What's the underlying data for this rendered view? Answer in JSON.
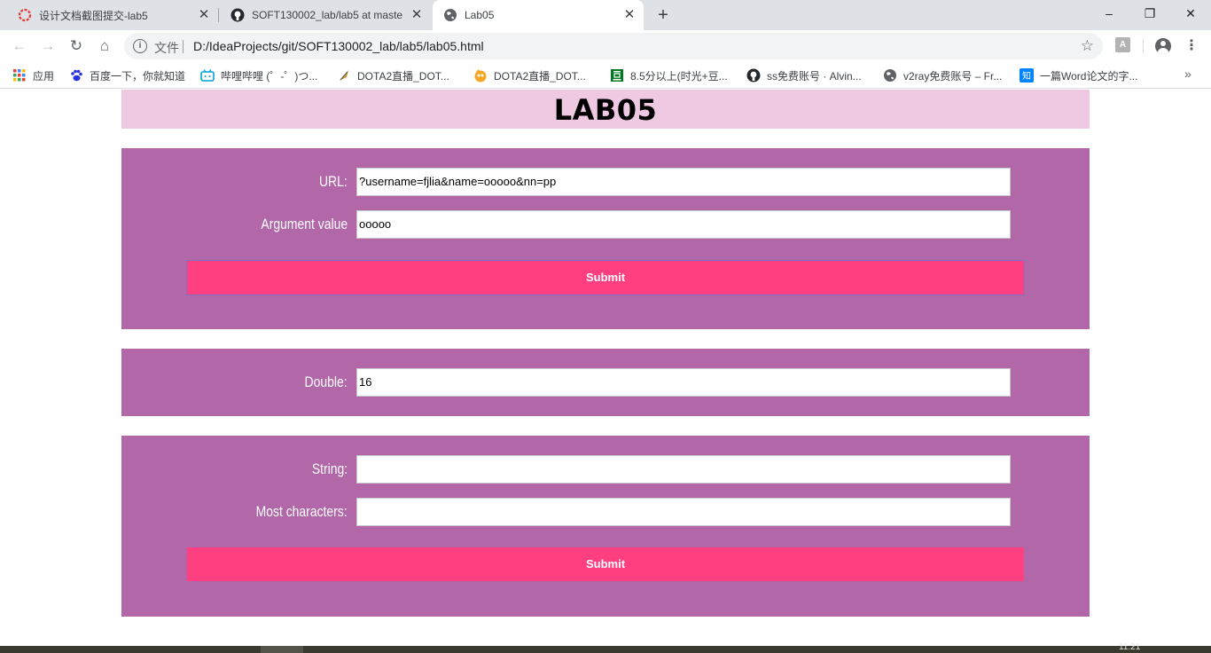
{
  "browser": {
    "tabs": [
      {
        "title": "设计文档截图提交-lab5",
        "icon": "red-dotted-circle-icon"
      },
      {
        "title": "SOFT130002_lab/lab5 at maste",
        "icon": "github-icon"
      },
      {
        "title": "Lab05",
        "icon": "globe-icon"
      }
    ],
    "address": {
      "file_label": "文件",
      "url": "D:/IdeaProjects/git/SOFT130002_lab/lab5/lab05.html"
    },
    "bookmarks": [
      {
        "label": "应用",
        "icon": "apps-grid-icon"
      },
      {
        "label": "百度一下，你就知道",
        "icon": "baidu-paw-icon"
      },
      {
        "label": "哔哩哔哩 (゜-゜)つ...",
        "icon": "bilibili-tv-icon"
      },
      {
        "label": "DOTA2直播_DOT...",
        "icon": "dota-feather-icon"
      },
      {
        "label": "DOTA2直播_DOT...",
        "icon": "douyu-fish-icon"
      },
      {
        "label": "8.5分以上(时光+豆...",
        "icon": "douban-icon"
      },
      {
        "label": "ss免费账号 · Alvin...",
        "icon": "github-icon"
      },
      {
        "label": "v2ray免费账号 – Fr...",
        "icon": "globe-icon"
      },
      {
        "label": "一篇Word论文的字...",
        "icon": "zhihu-icon"
      }
    ],
    "colors": {
      "tab_strip": "#dee1e6",
      "omnibox": "#f1f3f4"
    }
  },
  "page": {
    "heading": "LAB05",
    "panel1": {
      "url_label": "URL:",
      "url_value": "?username=fjlia&name=ooooo&nn=pp",
      "arg_label": "Argument value",
      "arg_value": "ooooo",
      "submit_label": "Submit"
    },
    "panel2": {
      "double_label": "Double:",
      "double_value": "16"
    },
    "panel3": {
      "string_label": "String:",
      "string_value": "",
      "most_label": "Most characters:",
      "most_value": "",
      "submit_label": "Submit"
    },
    "colors": {
      "header_bg": "#efc8e1",
      "panel_bg": "#b167a8",
      "button_bg": "#ff3f7f"
    }
  },
  "taskbar": {
    "clock": "11:21"
  }
}
